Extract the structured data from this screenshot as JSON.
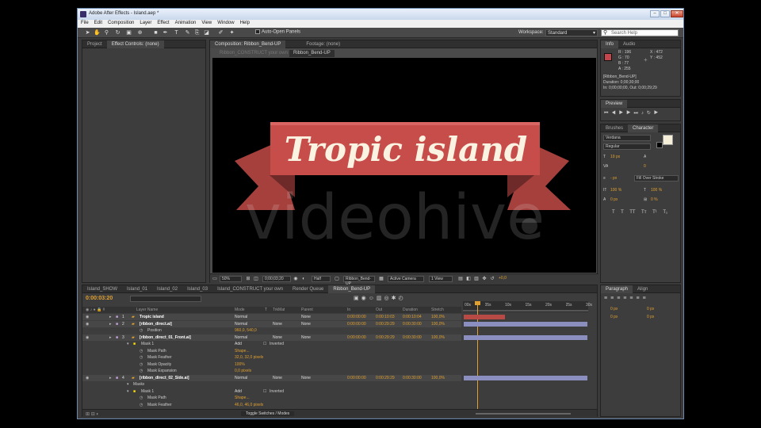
{
  "window": {
    "title": "Adobe After Effects - Island.aep *"
  },
  "menu": [
    "File",
    "Edit",
    "Composition",
    "Layer",
    "Effect",
    "Animation",
    "View",
    "Window",
    "Help"
  ],
  "toolbar": {
    "auto_open": "Auto-Open Panels",
    "workspace_label": "Workspace:",
    "workspace_value": "Standard",
    "search_placeholder": "Search Help"
  },
  "left_panel": {
    "tabs": [
      "Project",
      "Effect Controls: (none)"
    ]
  },
  "comp_panel": {
    "tabs": [
      "Composition: Ribbon_Bend-UP",
      "Footage: (none)"
    ],
    "subtab": "Ribbon_Bend-UP",
    "dim_breadcrumb": "Ribbon_CONSTRUCT your own",
    "viewer_text": "Tropic island",
    "watermark": "videohive",
    "footer": {
      "zoom": "50%",
      "timecode": "0;00;03;20",
      "resolution": "Half",
      "layer": "Ribbon_Bend-UP",
      "camera": "Active Camera",
      "views": "1 View",
      "exposure": "+0,0"
    }
  },
  "info_panel": {
    "tabs": [
      "Info",
      "Audio"
    ],
    "r": "R : 196",
    "g": "G : 70",
    "b": "B : 77",
    "a": "A : 255",
    "x": "X : 472",
    "y": "Y : 452",
    "layer": "[Ribbon_Bend-UP]",
    "duration": "Duration: 0;00;30;00",
    "inout": "In: 0;00;00;00, Out: 0;00;29;29",
    "swatch": "#c4464d"
  },
  "preview_panel": {
    "tabs": [
      "Preview"
    ]
  },
  "char_panel": {
    "tabs": [
      "Brushes",
      "Character"
    ],
    "font": "Verdana",
    "style": "Regular",
    "size": "19 px",
    "tracking": "0",
    "stroke": "- px",
    "stroke_mode": "Fill Over Stroke",
    "vscale": "100 %",
    "hscale": "100 %",
    "baseline": "0 px",
    "tsume": "0 %",
    "typo": [
      "T",
      "T",
      "TT",
      "Tт",
      "T¹",
      "T₁"
    ]
  },
  "para_panel": {
    "tabs": [
      "Paragraph",
      "Align"
    ],
    "indent1": "0 px",
    "indent2": "0 px",
    "space1": "0 px",
    "space2": "0 px"
  },
  "timeline": {
    "tabs": [
      "Island_SHOW",
      "Island_01",
      "Island_02",
      "Island_03",
      "Island_CONSTRUCT your own",
      "Render Queue",
      "Ribbon_Bend-UP"
    ],
    "timecode": "0:00:03:20",
    "headers": {
      "name": "Layer Name",
      "mode": "Mode",
      "t": "T",
      "trkmat": "TrkMat",
      "parent": "Parent",
      "in": "In",
      "out": "Out",
      "duration": "Duration",
      "stretch": "Stretch"
    },
    "ruler": [
      "00s",
      "05s",
      "10s",
      "15s",
      "20s",
      "25s",
      "30s"
    ],
    "toggle": "Toggle Switches / Modes",
    "rows": [
      {
        "kind": "layer",
        "num": "1",
        "name": "Tropic island",
        "mode": "Normal",
        "trkmat": "",
        "parent": "None",
        "in": "0:00:00:00",
        "out": "0:00:10:03",
        "dur": "0:00:10:04",
        "str": "100,0%"
      },
      {
        "kind": "layer",
        "num": "2",
        "name": "[ribbon_direct.ai]",
        "mode": "Normal",
        "trkmat": "None",
        "parent": "None",
        "in": "0:00:00:00",
        "out": "0:00:29:29",
        "dur": "0:00:30:00",
        "str": "100,0%"
      },
      {
        "kind": "prop",
        "name": "Position",
        "value": "960,0, 540,0"
      },
      {
        "kind": "layer",
        "num": "3",
        "name": "[ribbon_direct_01_Front.ai]",
        "mode": "Normal",
        "trkmat": "None",
        "parent": "None",
        "in": "0:00:00:00",
        "out": "0:00:29:29",
        "dur": "0:00:30:00",
        "str": "100,0%"
      },
      {
        "kind": "mask",
        "name": "Mask 1",
        "mode": "Add",
        "inverted": "Inverted"
      },
      {
        "kind": "prop",
        "name": "Mask Path",
        "value": "Shape..."
      },
      {
        "kind": "prop",
        "name": "Mask Feather",
        "value": "32,0, 32,0 pixels"
      },
      {
        "kind": "prop",
        "name": "Mask Opacity",
        "value": "100%"
      },
      {
        "kind": "prop",
        "name": "Mask Expansion",
        "value": "0,0 pixels"
      },
      {
        "kind": "layer",
        "num": "4",
        "name": "[ribbon_direct_02_Side.ai]",
        "mode": "Normal",
        "trkmat": "None",
        "parent": "None",
        "in": "0:00:00:00",
        "out": "0:00:29:29",
        "dur": "0:00:30:00",
        "str": "100,0%"
      },
      {
        "kind": "group",
        "name": "Masks"
      },
      {
        "kind": "mask",
        "name": "Mask 1",
        "mode": "Add",
        "inverted": "Inverted"
      },
      {
        "kind": "prop",
        "name": "Mask Path",
        "value": "Shape..."
      },
      {
        "kind": "prop",
        "name": "Mask Feather",
        "value": "46,0, 46,0 pixels"
      }
    ]
  }
}
